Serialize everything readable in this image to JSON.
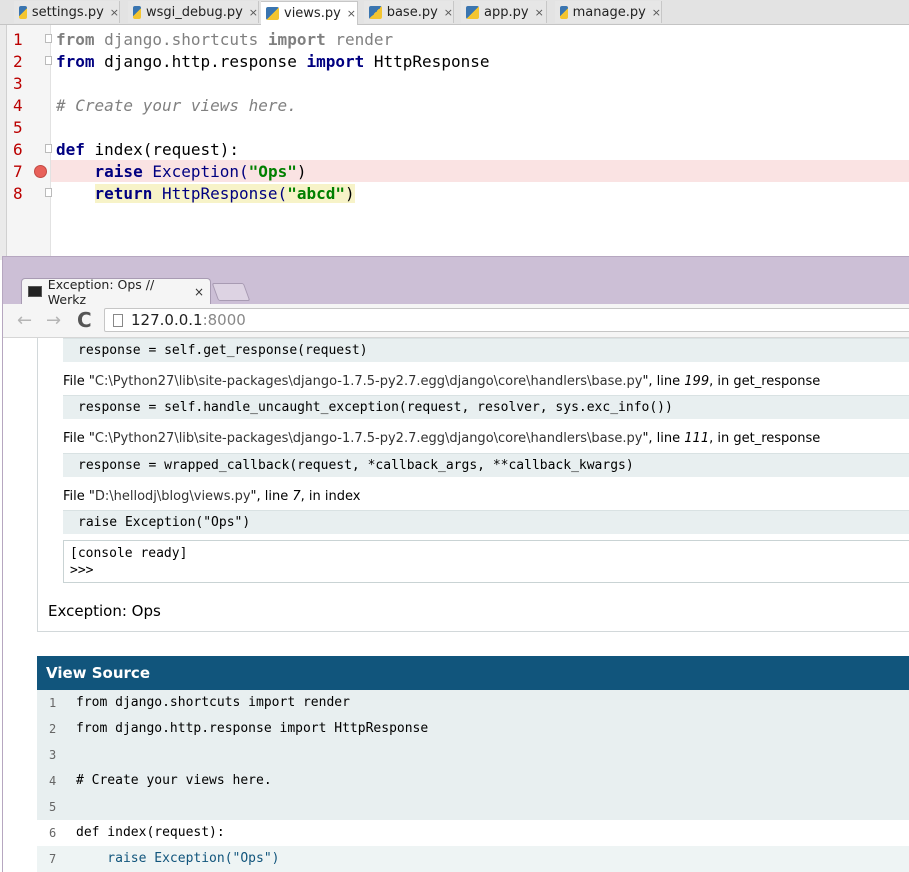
{
  "ide": {
    "tabs": [
      {
        "label": "settings.py",
        "close": "×",
        "active": false
      },
      {
        "label": "wsgi_debug.py",
        "close": "×",
        "active": false
      },
      {
        "label": "views.py",
        "close": "×",
        "active": true
      },
      {
        "label": "base.py",
        "close": "×",
        "active": false
      },
      {
        "label": "app.py",
        "close": "×",
        "active": false
      },
      {
        "label": "manage.py",
        "close": "×",
        "active": false
      }
    ],
    "line_numbers": [
      "1",
      "2",
      "3",
      "4",
      "5",
      "6",
      "7",
      "8"
    ],
    "breakpoint_line": "7",
    "code": {
      "l1": {
        "kw1": "from",
        "mod": " django.shortcuts ",
        "kw2": "import",
        "name": " render"
      },
      "l2": {
        "kw1": "from",
        "mod": " django.http.response ",
        "kw2": "import",
        "name": " HttpResponse"
      },
      "l4": {
        "comment": "# Create your views here."
      },
      "l6": {
        "kw": "def",
        "rest": " index(request):"
      },
      "l7": {
        "indent": "    ",
        "kw": "raise",
        "cls": " Exception(",
        "str": "\"Ops\"",
        "end": ")"
      },
      "l8": {
        "indent": "    ",
        "kw": "return",
        "cls": " HttpResponse(",
        "str": "\"abcd\"",
        "end": ")"
      }
    }
  },
  "browser": {
    "tab_title": "Exception: Ops // Werkz",
    "tab_close": "×",
    "url_host": "127.0.0.1",
    "url_port": ":8000",
    "back_icon": "←",
    "forward_icon": "→",
    "reload_icon": "C"
  },
  "traceback": {
    "lines": [
      {
        "type": "code",
        "text": "response = self.get_response(request)"
      },
      {
        "type": "file",
        "pre": "File \"",
        "path": "C:\\Python27\\lib\\site-packages\\django-1.7.5-py2.7.egg\\django\\core\\handlers\\base.py",
        "mid": "\", line ",
        "line": "199",
        "post": ", in get_response"
      },
      {
        "type": "code",
        "text": "response = self.handle_uncaught_exception(request, resolver, sys.exc_info())"
      },
      {
        "type": "file",
        "pre": "File \"",
        "path": "C:\\Python27\\lib\\site-packages\\django-1.7.5-py2.7.egg\\django\\core\\handlers\\base.py",
        "mid": "\", line ",
        "line": "111",
        "post": ", in get_response"
      },
      {
        "type": "code",
        "text": "response = wrapped_callback(request, *callback_args, **callback_kwargs)"
      },
      {
        "type": "file",
        "pre": "File \"",
        "path": "D:\\hellodj\\blog\\views.py",
        "mid": "\", line ",
        "line": "7",
        "post": ", in index"
      },
      {
        "type": "code",
        "text": "raise Exception(\"Ops\")"
      }
    ],
    "console_line1": "[console ready]",
    "console_line2": ">>>",
    "exception": "Exception: Ops"
  },
  "view_source": {
    "header": "View Source",
    "rows": [
      {
        "n": "1",
        "code": "from django.shortcuts import render"
      },
      {
        "n": "2",
        "code": "from django.http.response import HttpResponse"
      },
      {
        "n": "3",
        "code": ""
      },
      {
        "n": "4",
        "code": "# Create your views here."
      },
      {
        "n": "5",
        "code": ""
      },
      {
        "n": "6",
        "code": "def index(request):"
      },
      {
        "n": "7",
        "code": "    raise Exception(\"Ops\")"
      }
    ]
  }
}
